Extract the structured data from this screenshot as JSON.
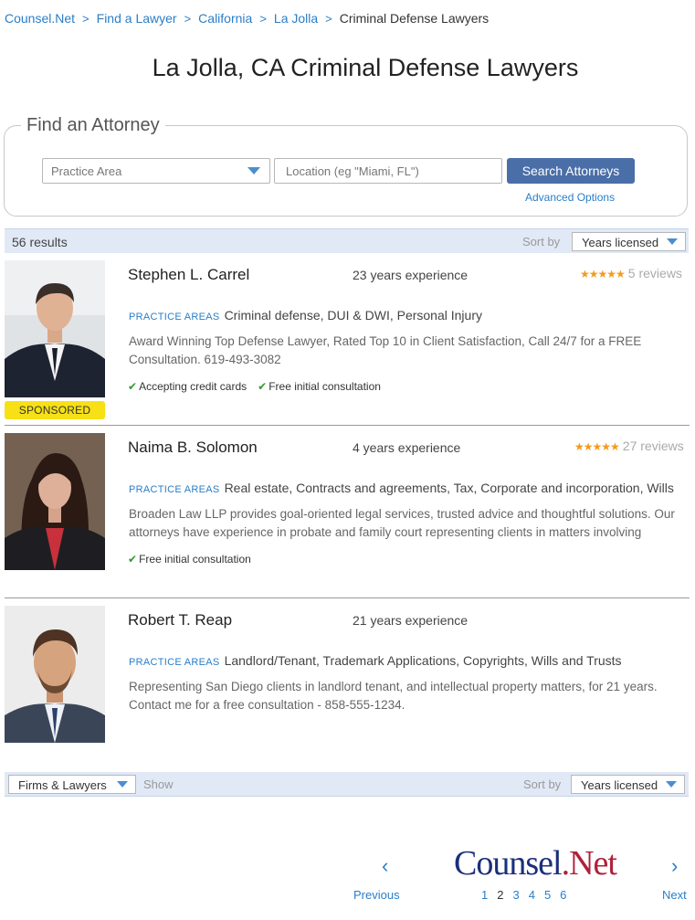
{
  "breadcrumb": {
    "items": [
      "Counsel.Net",
      "Find a Lawyer",
      "California",
      "La Jolla"
    ],
    "current": "Criminal Defense Lawyers"
  },
  "page_title": "La Jolla, CA Criminal Defense Lawyers",
  "search": {
    "legend": "Find an Attorney",
    "practice_placeholder": "Practice Area",
    "location_placeholder": "Location (eg \"Miami, FL\")",
    "button_label": "Search Attorneys",
    "advanced_label": "Advanced Options"
  },
  "results": {
    "count_label": "56 results",
    "sort_label": "Sort by",
    "sort_value": "Years licensed"
  },
  "lawyers": [
    {
      "name": "Stephen L. Carrel",
      "experience": "23 years experience",
      "stars": "★★★★★",
      "reviews": "5 reviews",
      "practice_label": "PRACTICE AREAS",
      "practice_areas": "Criminal defense, DUI & DWI, Personal Injury",
      "description_line1": "Award Winning Top Defense Lawyer, Rated Top 10 in Client Satisfaction, Call 24/7 for a FREE",
      "description_line2": "Consultation. 619-493-3082",
      "features": [
        "Accepting credit cards",
        "Free initial consultation"
      ],
      "sponsored": "SPONSORED"
    },
    {
      "name": "Naima B. Solomon",
      "experience": "4 years experience",
      "stars": "★★★★★",
      "reviews": "27 reviews",
      "practice_label": "PRACTICE AREAS",
      "practice_areas": "Real estate, Contracts and agreements, Tax, Corporate and incorporation, Wills",
      "description_line1": "Broaden Law LLP provides goal-oriented legal services, trusted advice and thoughtful solutions. Our",
      "description_line2": "attorneys have experience in probate and family court representing clients in matters involving",
      "features": [
        "Free initial consultation"
      ]
    },
    {
      "name": "Robert T. Reap",
      "experience": "21 years experience",
      "practice_label": "PRACTICE AREAS",
      "practice_areas": "Landlord/Tenant, Trademark Applications, Copyrights, Wills and Trusts",
      "description_line1": "Representing San Diego clients in landlord tenant, and intellectual property matters, for 21 years.",
      "description_line2": "Contact me for a free consultation - 858-555-1234."
    }
  ],
  "bottom_bar": {
    "firms_value": "Firms & Lawyers",
    "show_label": "Show",
    "sort_label": "Sort by",
    "sort_value": "Years licensed"
  },
  "pager": {
    "prev_arrow": "‹",
    "prev_label": "Previous",
    "next_arrow": "›",
    "next_label": "Next",
    "pages": [
      "1",
      "2",
      "3",
      "4",
      "5",
      "6"
    ],
    "current_page": "2"
  },
  "logo": {
    "main": "Counsel",
    "suffix": ".Net"
  },
  "colors": {
    "link": "#2a7ec8",
    "button": "#4a6fa8",
    "bar": "#e1e9f6",
    "stars": "#f39b1f",
    "sponsored": "#f7e015",
    "check": "#2f9a2f"
  }
}
